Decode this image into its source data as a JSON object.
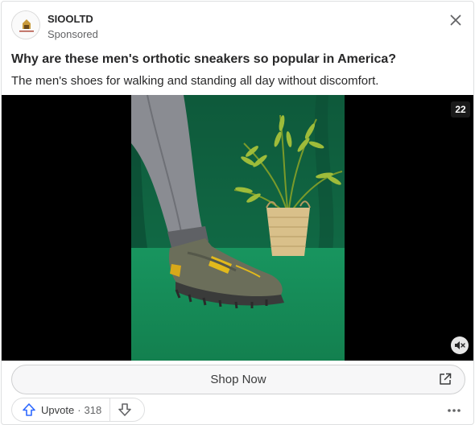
{
  "ad": {
    "brand": "SIOOLTD",
    "sponsored_label": "Sponsored",
    "headline": "Why are these men's orthotic sneakers so popular in America?",
    "description": "The men's shoes for walking and standing all day without discomfort."
  },
  "video": {
    "duration_badge": "22",
    "muted": true
  },
  "cta": {
    "label": "Shop Now"
  },
  "actions": {
    "upvote_label": "Upvote",
    "separator": "·",
    "upvote_count": "318"
  },
  "icons": {
    "close": "close-icon",
    "mute": "muted-speaker-icon",
    "external": "external-link-icon",
    "upvote": "upvote-arrow-icon",
    "downvote": "downvote-arrow-icon",
    "more": "more-horizontal-icon"
  },
  "colors": {
    "backdrop_green": "#1f8a5c",
    "upvote_blue": "#2e69ff",
    "text_primary": "#282829",
    "text_secondary": "#636466"
  }
}
